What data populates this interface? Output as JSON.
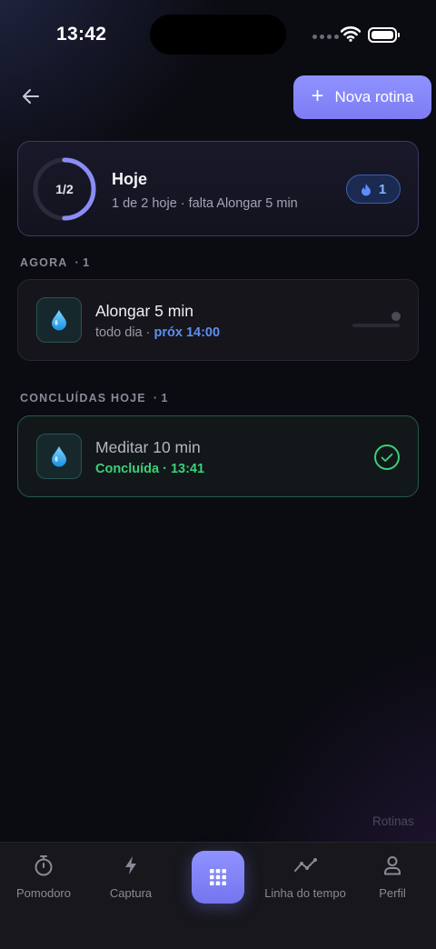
{
  "status_bar": {
    "time": "13:42"
  },
  "header": {
    "new_routine_label": "Nova rotina"
  },
  "summary": {
    "ring_label": "1/2",
    "progress": 0.5,
    "title": "Hoje",
    "subtitle": "1 de 2 hoje · falta Alongar 5 min",
    "streak_count": "1"
  },
  "sections": {
    "now": {
      "label": "AGORA",
      "count": "· 1"
    },
    "done": {
      "label": "CONCLUÍDAS HOJE",
      "count": "· 1"
    }
  },
  "routines_now": [
    {
      "title": "Alongar 5 min",
      "schedule": "todo dia ·",
      "next": "próx 14:00",
      "icon": "drop-icon"
    }
  ],
  "routines_done": [
    {
      "title": "Meditar 10 min",
      "status": "Concluída · 13:41",
      "icon": "drop-icon"
    }
  ],
  "footer_label": "Rotinas",
  "tabbar": {
    "items": [
      {
        "label": "Pomodoro",
        "icon": "stopwatch-icon"
      },
      {
        "label": "Captura",
        "icon": "lightning-icon"
      },
      {
        "label": "",
        "icon": "grid-icon"
      },
      {
        "label": "Linha do tempo",
        "icon": "timeline-icon"
      },
      {
        "label": "Perfil",
        "icon": "user-icon"
      }
    ]
  },
  "colors": {
    "accent": "#8f92ff",
    "success": "#3ecf7a",
    "link": "#5d8ff3",
    "background": "#0b0b12"
  }
}
